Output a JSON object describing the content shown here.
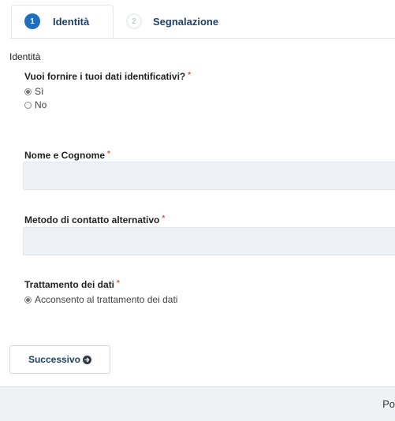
{
  "tabs": [
    {
      "step": "1",
      "label": "Identità"
    },
    {
      "step": "2",
      "label": "Segnalazione"
    }
  ],
  "section_title": "Identità",
  "q_identity": {
    "label": "Vuoi fornire i tuoi dati identificativi?",
    "required_mark": "*",
    "options": [
      "Sì",
      "No"
    ],
    "selected": "Sì"
  },
  "name_field": {
    "label": "Nome e Cognome",
    "required_mark": "*",
    "value": ""
  },
  "contact_field": {
    "label": "Metodo di contatto alternativo",
    "required_mark": "*",
    "value": ""
  },
  "consent": {
    "label": "Trattamento dei dati",
    "required_mark": "*",
    "option": "Acconsento al trattamento dei dati"
  },
  "next_button": {
    "label": "Successivo",
    "icon": "arrow-right-circle-icon"
  },
  "footer": {
    "text": "Po"
  }
}
